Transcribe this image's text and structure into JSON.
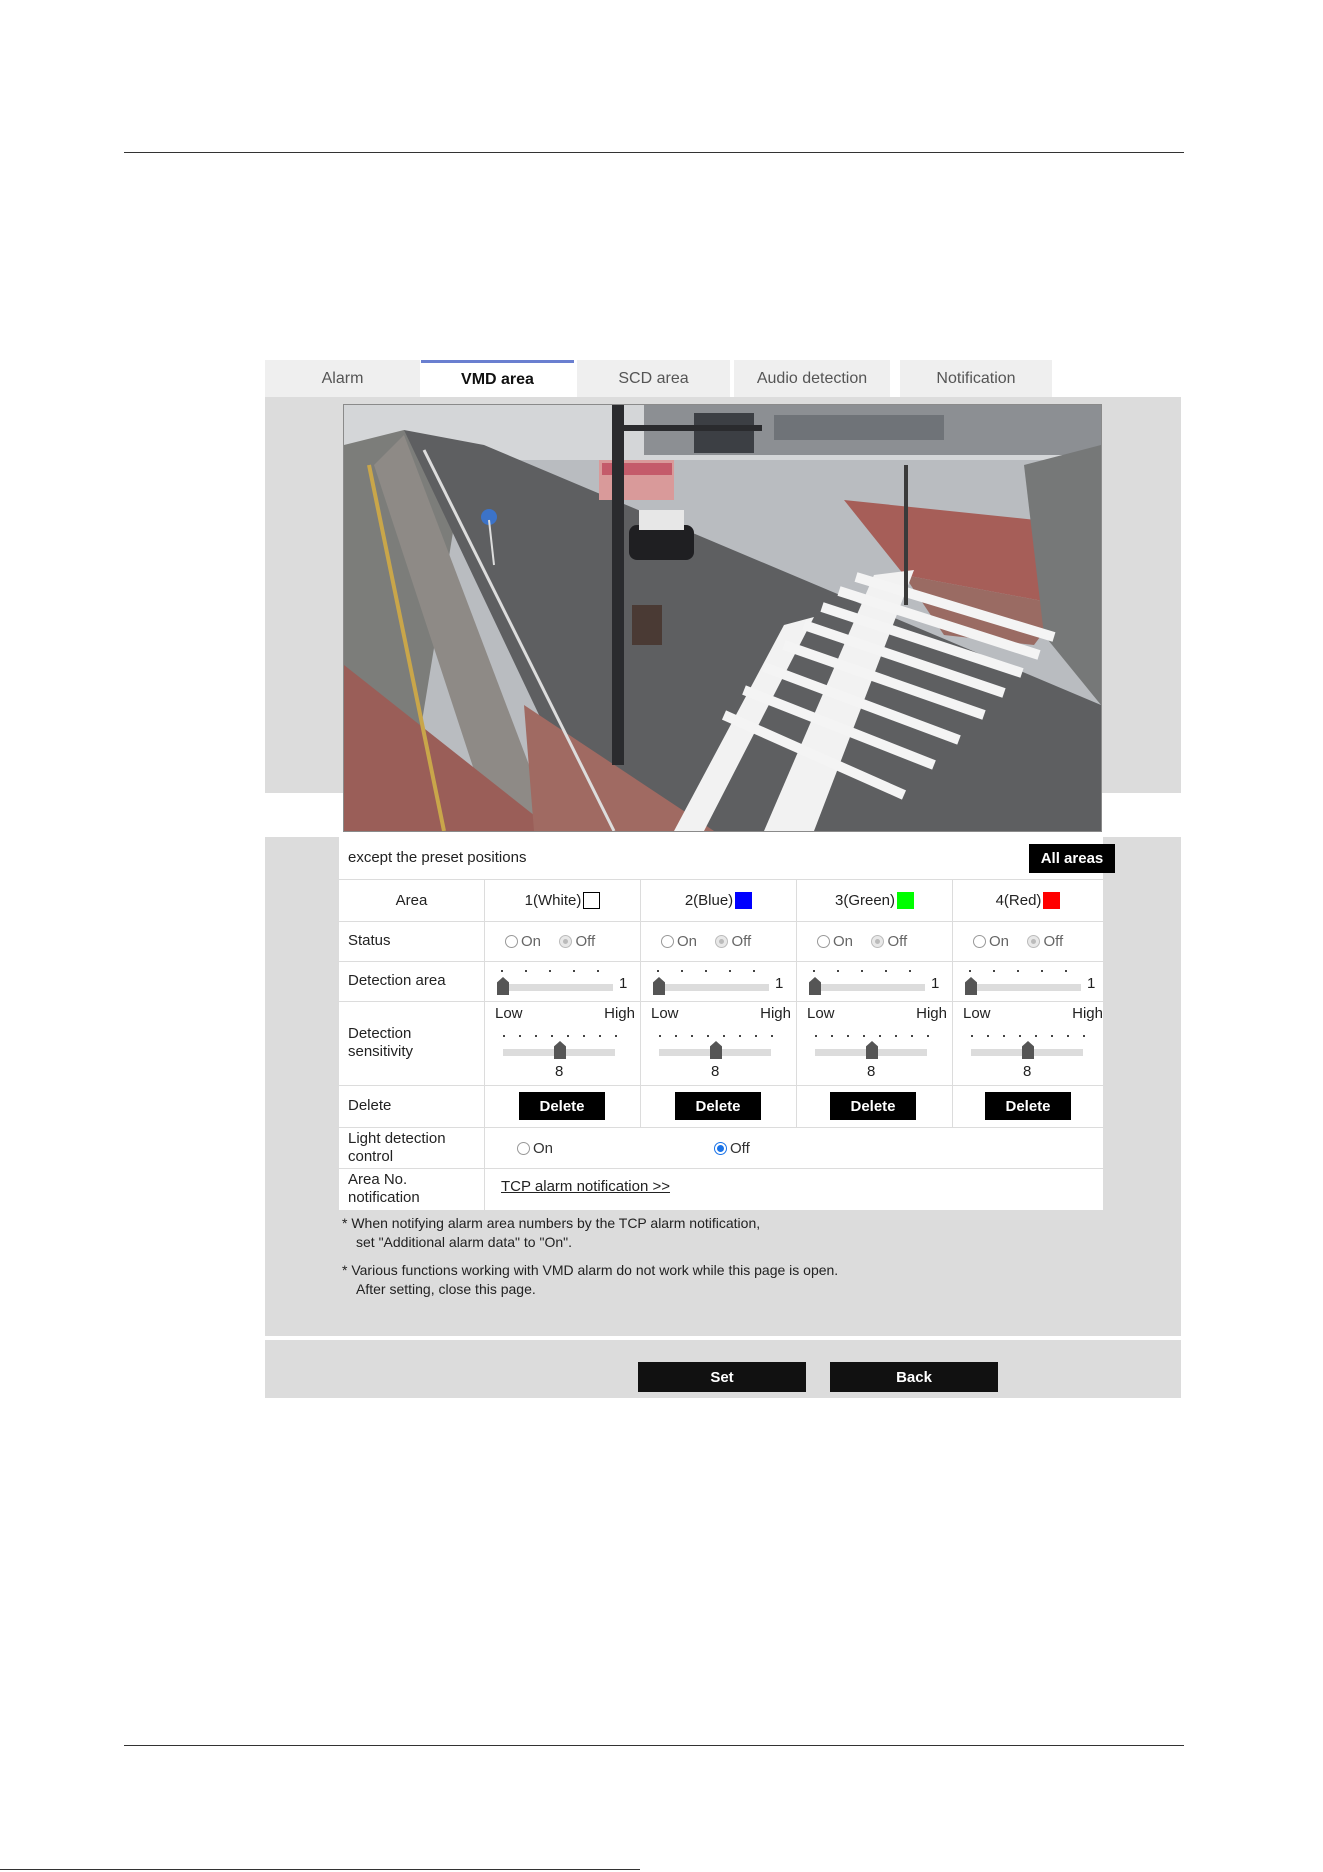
{
  "tabs": [
    {
      "label": "Alarm",
      "active": false
    },
    {
      "label": "VMD area",
      "active": true
    },
    {
      "label": "SCD area",
      "active": false
    },
    {
      "label": "Audio detection",
      "active": false
    },
    {
      "label": "Notification",
      "active": false
    }
  ],
  "preset_text": "except the preset positions",
  "all_areas_label": "All areas",
  "rows": {
    "area": "Area",
    "status": "Status",
    "detection_area": "Detection area",
    "sensitivity": "Detection sensitivity",
    "delete": "Delete",
    "light": "Light detection control",
    "area_no": "Area No. notification"
  },
  "areas": [
    {
      "label": "1(White)",
      "color": "#ffffff",
      "status_on": "On",
      "status_off": "Off",
      "detection_value": "1",
      "low": "Low",
      "high": "High",
      "sensitivity_value": "8",
      "sensitivity_level": 8,
      "delete_label": "Delete"
    },
    {
      "label": "2(Blue)",
      "color": "#0000ff",
      "status_on": "On",
      "status_off": "Off",
      "detection_value": "1",
      "low": "Low",
      "high": "High",
      "sensitivity_value": "8",
      "sensitivity_level": 8,
      "delete_label": "Delete"
    },
    {
      "label": "3(Green)",
      "color": "#00ff00",
      "status_on": "On",
      "status_off": "Off",
      "detection_value": "1",
      "low": "Low",
      "high": "High",
      "sensitivity_value": "8",
      "sensitivity_level": 8,
      "delete_label": "Delete"
    },
    {
      "label": "4(Red)",
      "color": "#ff0000",
      "status_on": "On",
      "status_off": "Off",
      "detection_value": "1",
      "low": "Low",
      "high": "High",
      "sensitivity_value": "8",
      "sensitivity_level": 8,
      "delete_label": "Delete"
    }
  ],
  "light": {
    "on": "On",
    "off": "Off",
    "selected": "Off"
  },
  "tcp_link": "TCP alarm notification >>",
  "notes": {
    "n1a": "* When notifying alarm area numbers by the TCP alarm notification,",
    "n1b": "set \"Additional alarm data\" to \"On\".",
    "n2a": "* Various functions working with VMD alarm do not work while this page is open.",
    "n2b": "After setting, close this page."
  },
  "buttons": {
    "set": "Set",
    "back": "Back"
  },
  "colors": {
    "tab_accent": "#6a7fd0",
    "panel_bg": "#dcdcdc",
    "button_bg": "#000000"
  }
}
